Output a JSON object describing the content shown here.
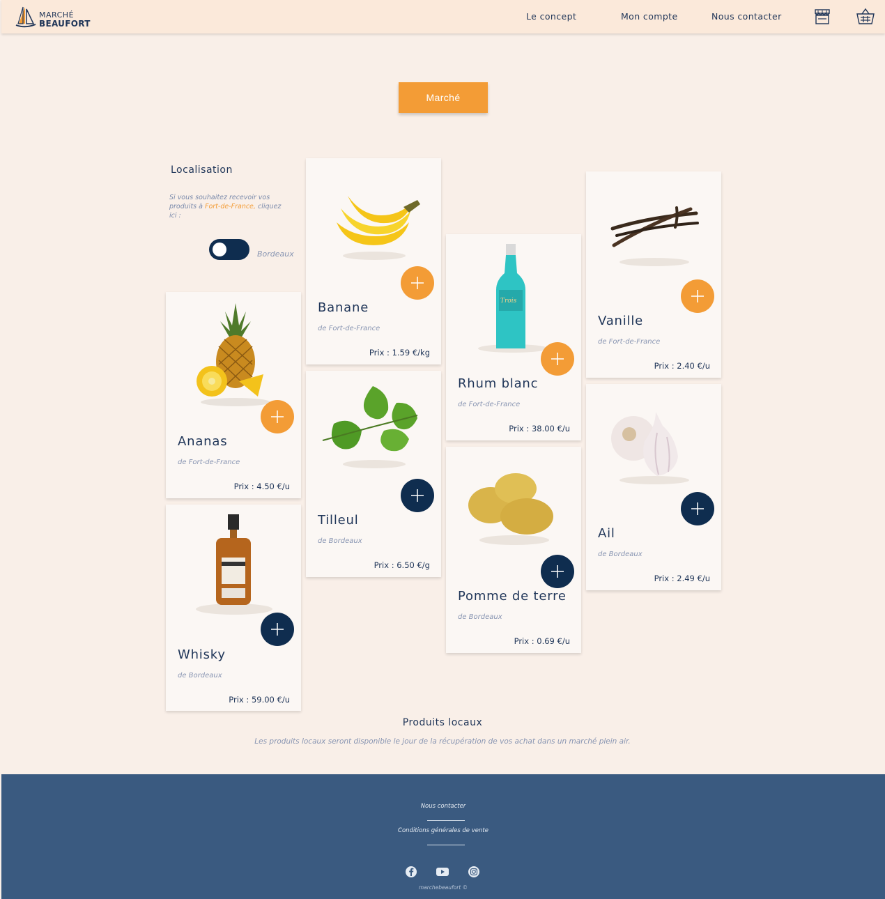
{
  "brand": {
    "line1": "MARCHÉ",
    "line2": "BEAUFORT"
  },
  "nav": {
    "concept": "Le concept",
    "account": "Mon compte",
    "contact": "Nous contacter"
  },
  "icons": {
    "store": "store-icon",
    "basket": "basket-icon"
  },
  "market_button": "Marché",
  "location": {
    "title": "Localisation",
    "text_before": "Si vous souhaitez recevoir vos produits à ",
    "city_link": "Fort-de-France,",
    "text_after": " cliquez ici :",
    "toggle_label": "Bordeaux"
  },
  "colors": {
    "accent": "#f39c36",
    "navy": "#0f2d4f",
    "footer": "#3a5a80",
    "background": "#f9efe8"
  },
  "price_prefix": "Prix :",
  "products": [
    {
      "name": "Ananas",
      "origin": "de Fort-de-France",
      "price": "4.50 €/u",
      "button": "orange"
    },
    {
      "name": "Whisky",
      "origin": "de Bordeaux",
      "price": "59.00 €/u",
      "button": "navy"
    },
    {
      "name": "Banane",
      "origin": "de Fort-de-France",
      "price": "1.59 €/kg",
      "button": "orange"
    },
    {
      "name": "Tilleul",
      "origin": "de Bordeaux",
      "price": "6.50 €/g",
      "button": "navy"
    },
    {
      "name": "Rhum blanc",
      "origin": "de Fort-de-France",
      "price": "38.00 €/u",
      "button": "orange"
    },
    {
      "name": "Pomme de terre",
      "origin": "de Bordeaux",
      "price": "0.69 €/u",
      "button": "navy"
    },
    {
      "name": "Vanille",
      "origin": "de Fort-de-France",
      "price": "2.40 €/u",
      "button": "orange"
    },
    {
      "name": "Ail",
      "origin": "de Bordeaux",
      "price": "2.49 €/u",
      "button": "navy"
    }
  ],
  "local": {
    "title": "Produits locaux",
    "text": "Les produits locaux seront disponible le jour de la récupération de vos achat dans un marché plein air."
  },
  "footer": {
    "contact": "Nous contacter",
    "terms": "Conditions générales de vente",
    "social": [
      "facebook-icon",
      "youtube-icon",
      "instagram-icon"
    ],
    "copyright": "marchebeaufort ©"
  }
}
